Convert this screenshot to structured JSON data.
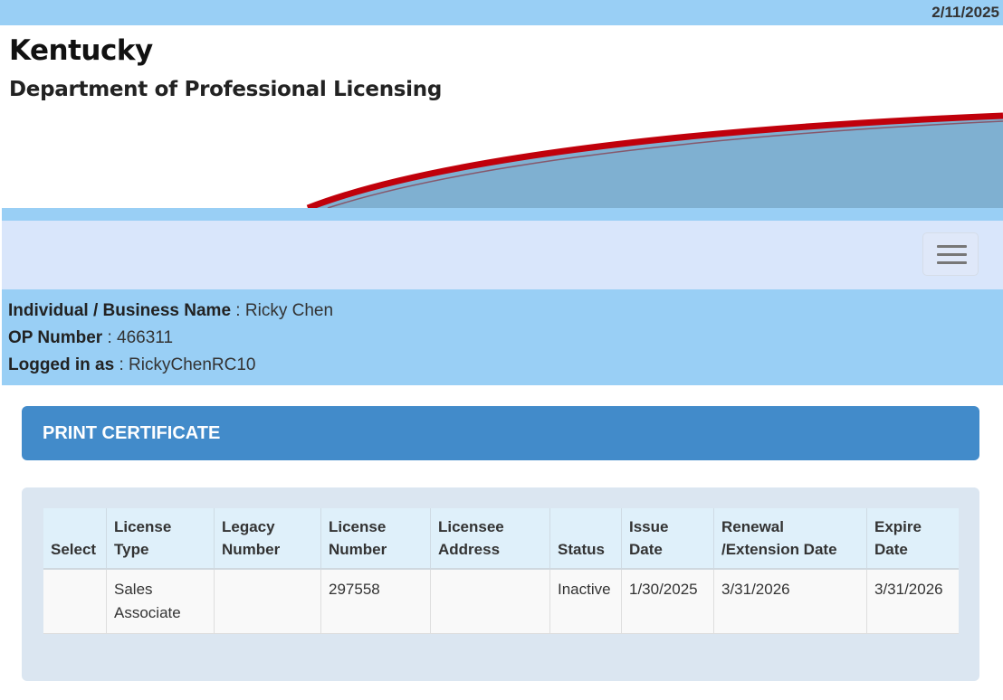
{
  "header": {
    "date": "2/11/2025",
    "state_name": "Kentucky",
    "department": "Department of Professional Licensing"
  },
  "navbar": {
    "menu_icon": "hamburger-menu-icon"
  },
  "user": {
    "name_label": "Individual / Business Name",
    "name_value": "Ricky Chen",
    "op_label": "OP Number",
    "op_value": "466311",
    "login_label": "Logged in as",
    "login_value": "RickyChenRC10",
    "separator": " : "
  },
  "panel": {
    "title": "PRINT CERTIFICATE"
  },
  "table": {
    "headers": {
      "select": "Select",
      "license_type": [
        "License",
        "Type"
      ],
      "legacy_number": [
        "Legacy",
        "Number"
      ],
      "license_number": [
        "License",
        "Number"
      ],
      "licensee_address": [
        "Licensee",
        "Address"
      ],
      "status": "Status",
      "issue_date": [
        "Issue",
        "Date"
      ],
      "renewal_date": [
        "Renewal",
        "/Extension Date"
      ],
      "expire_date": [
        "Expire",
        "Date"
      ]
    },
    "rows": [
      {
        "select": "",
        "license_type": [
          "Sales",
          "Associate"
        ],
        "legacy_number": "",
        "license_number": "297558",
        "licensee_address": "",
        "status": "Inactive",
        "issue_date": "1/30/2025",
        "renewal_date": "3/31/2026",
        "expire_date": "3/31/2026"
      }
    ]
  },
  "colors": {
    "light_blue": "#99cff5",
    "nav_bg": "#d9e6fb",
    "panel_blue": "#428bca",
    "banner_red": "#c0000b",
    "banner_blue": "#7fb0d1"
  }
}
